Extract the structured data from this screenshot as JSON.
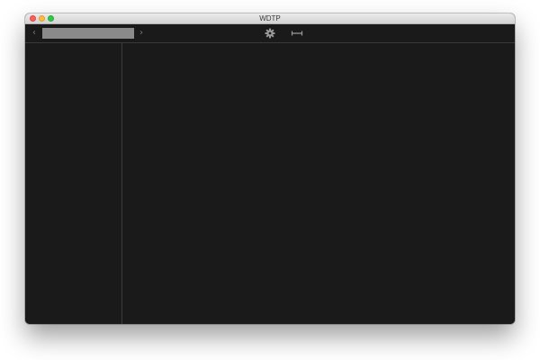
{
  "window": {
    "title": "WDTP",
    "traffic_lights": {
      "close_color": "#fc605c",
      "minimize_color": "#fdbc40",
      "maximize_color": "#34c84a"
    }
  },
  "toolbar": {
    "back_icon": "chevron-left-icon",
    "back_glyph": "‹",
    "forward_icon": "chevron-right-icon",
    "forward_glyph": "›",
    "address_value": "",
    "settings_icon": "gear-icon",
    "resize_icon": "horizontal-resize-icon"
  },
  "theme": {
    "background": "#1a1a1a",
    "divider": "#3c3c3c",
    "icon_color": "#9a9a9a"
  }
}
